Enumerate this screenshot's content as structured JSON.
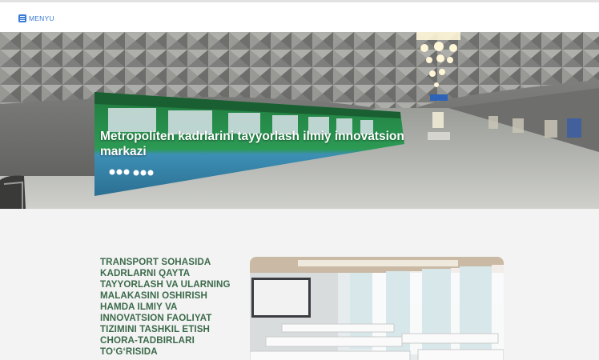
{
  "header": {
    "menu_label": "MENYU",
    "menu_icon": "menu-icon",
    "accent_color": "#3a7bd5"
  },
  "hero": {
    "title": "Metropoliten kadrlarini tayyorlash ilmiy innovatsion markazi"
  },
  "section": {
    "title": "TRANSPORT SOHASIDA KADRLARNI QAYTA TAYYORLASH VA ULARNING MALAKASINI OSHIRISH HAMDA ILMIY VA INNOVATSION FAOLIYAT TIZIMINI TASHKIL ETISH CHORA-TADBIRLARI TO‘G‘RISIDA",
    "title_color": "#3b6a4a"
  }
}
